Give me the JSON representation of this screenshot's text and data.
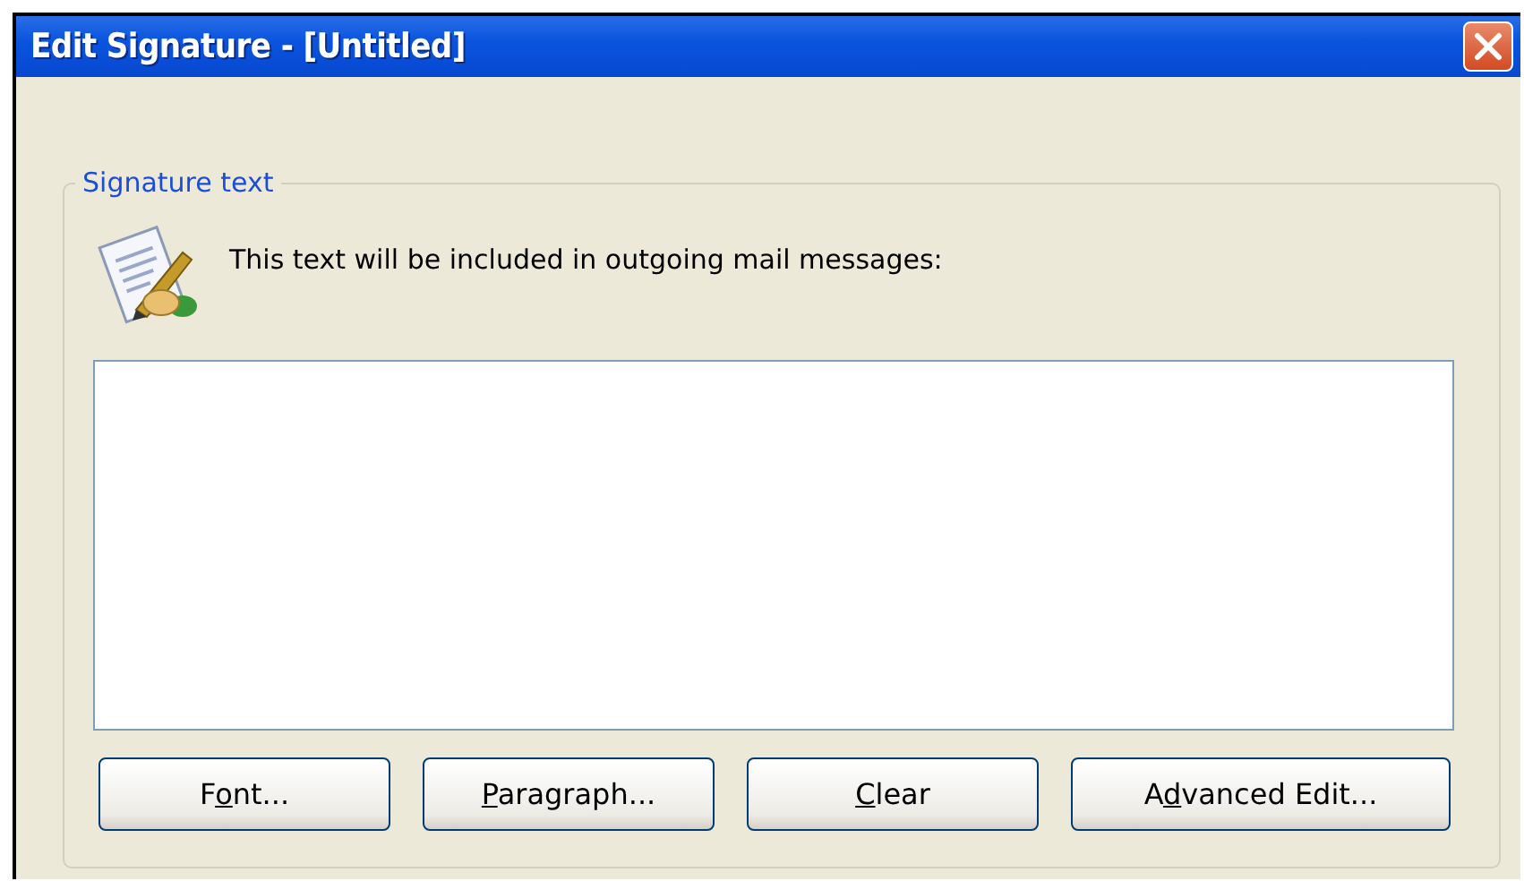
{
  "window": {
    "title": "Edit Signature - [Untitled]"
  },
  "group": {
    "label": "Signature text",
    "description": "This text will be included in outgoing mail messages:"
  },
  "buttons": [
    {
      "pre": "F",
      "key": "o",
      "post": "nt..."
    },
    {
      "key": "P",
      "post": "aragraph..."
    },
    {
      "key": "C",
      "post": "lear"
    },
    {
      "pre": "A",
      "key": "d",
      "post": "vanced Edit..."
    }
  ]
}
